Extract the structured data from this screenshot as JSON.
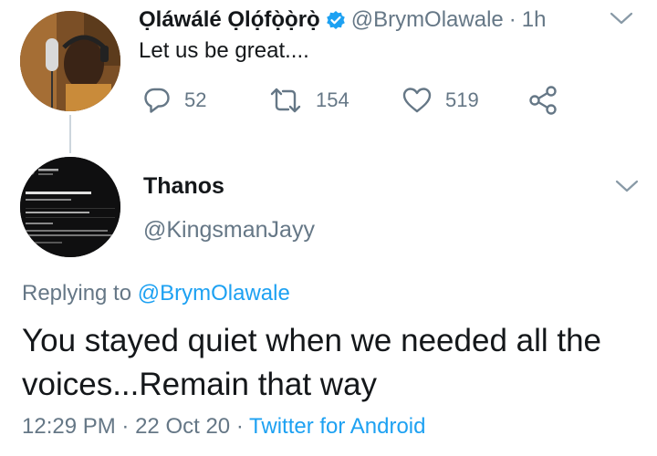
{
  "tweet": {
    "author_name": "Ọláwálé Ọlọ́fọ̀ọ̀rọ̀",
    "author_handle": "@BrymOlawale",
    "separator": "·",
    "time_ago": "1h",
    "text": "Let us be great....",
    "reply_count": "52",
    "retweet_count": "154",
    "like_count": "519"
  },
  "reply": {
    "author_name": "Thanos",
    "author_handle": "@KingsmanJayy",
    "replying_to_prefix": "Replying to",
    "replying_to_handle": "@BrymOlawale",
    "text": "You stayed quiet when we needed all the voices...Remain that way",
    "time": "12:29 PM",
    "separator_1": "·",
    "date": "22 Oct 20",
    "separator_2": "·",
    "source": "Twitter for Android"
  },
  "colors": {
    "text": "#14171a",
    "secondary": "#657786",
    "link": "#1da1f2",
    "verified": "#1da1f2",
    "thread_line": "#ccd6dd"
  },
  "icons": {
    "reply": "reply-icon",
    "retweet": "retweet-icon",
    "like": "heart-icon",
    "share": "share-icon",
    "verified": "verified-badge-icon",
    "menu": "chevron-down-icon"
  }
}
